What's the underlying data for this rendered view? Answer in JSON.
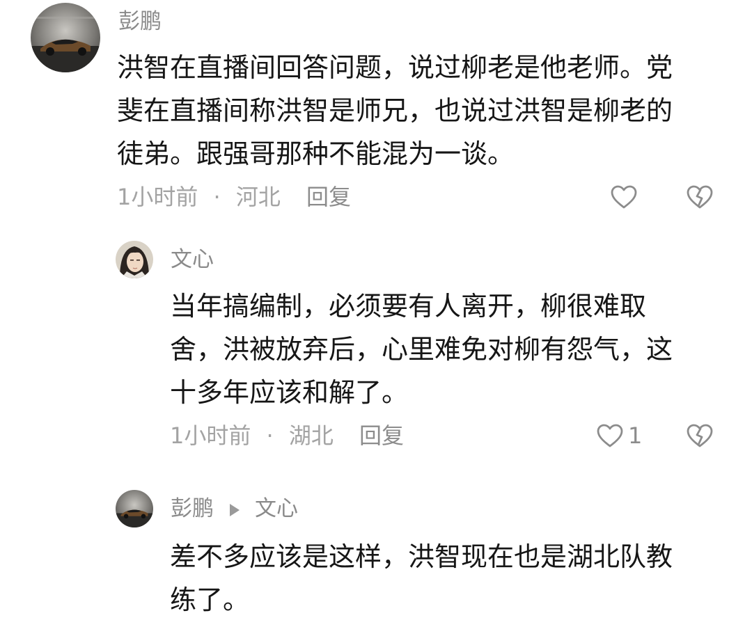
{
  "comments": [
    {
      "author": "彭鹏",
      "text": "洪智在直播间回答问题，说过柳老是他老师。党\n斐在直播间称洪智是师兄，也说过洪智是柳老的\n徒弟。跟强哥那种不能混为一谈。",
      "time": "1小时前",
      "location": "河北",
      "reply_label": "回复",
      "like_count": ""
    },
    {
      "author": "文心",
      "text": "当年搞编制，必须要有人离开，柳很难取\n舍，洪被放弃后，心里难免对柳有怨气，这\n十多年应该和解了。",
      "time": "1小时前",
      "location": "湖北",
      "reply_label": "回复",
      "like_count": "1"
    },
    {
      "author": "彭鹏",
      "reply_to": "文心",
      "text": "差不多应该是这样，洪智现在也是湖北队教\n练了。"
    }
  ],
  "separator": "·",
  "icons": [
    "avatar-car",
    "avatar-character",
    "heart-icon",
    "dislike-heart-icon",
    "reply-arrow-icon"
  ],
  "colors": {
    "name": "#8a8a8a",
    "text": "#161616",
    "meta": "#a3a3a3",
    "icon": "#8c8c8c"
  }
}
